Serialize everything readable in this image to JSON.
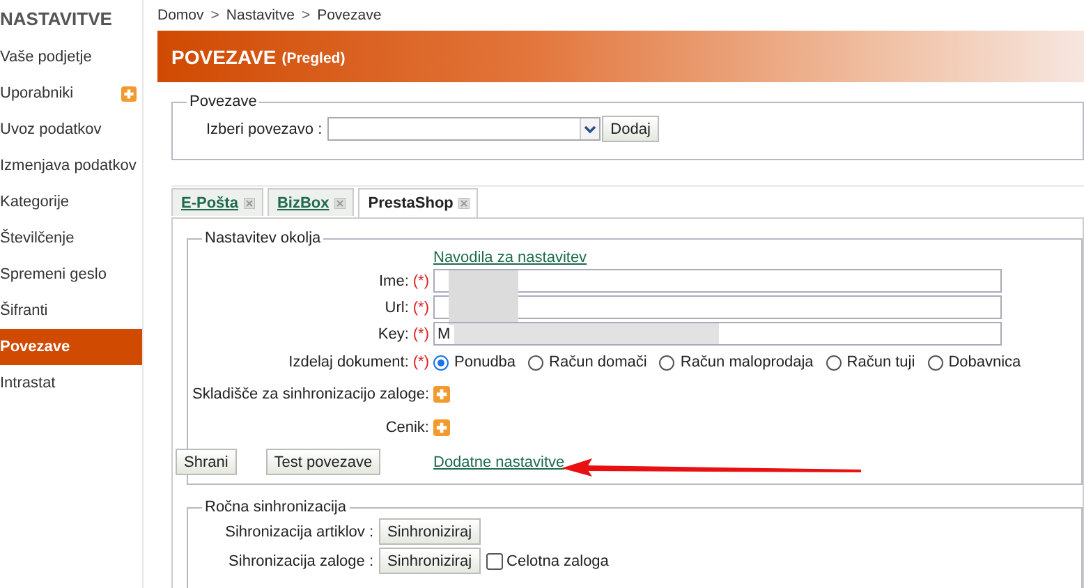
{
  "sidebar": {
    "title": "NASTAVITVE",
    "items": [
      {
        "label": "Vaše podjetje",
        "selected": false,
        "plus": false
      },
      {
        "label": "Uporabniki",
        "selected": false,
        "plus": true
      },
      {
        "label": "Uvoz podatkov",
        "selected": false,
        "plus": false
      },
      {
        "label": "Izmenjava podatkov",
        "selected": false,
        "plus": false
      },
      {
        "label": "Kategorije",
        "selected": false,
        "plus": false
      },
      {
        "label": "Številčenje",
        "selected": false,
        "plus": false
      },
      {
        "label": "Spremeni geslo",
        "selected": false,
        "plus": false
      },
      {
        "label": "Šifranti",
        "selected": false,
        "plus": false
      },
      {
        "label": "Povezave",
        "selected": true,
        "plus": false
      },
      {
        "label": "Intrastat",
        "selected": false,
        "plus": false
      }
    ]
  },
  "breadcrumb": [
    "Domov",
    "Nastavitve",
    "Povezave"
  ],
  "breadcrumb_separator": ">",
  "header": {
    "title": "POVEZAVE",
    "subtitle": "(Pregled)"
  },
  "connection_picker": {
    "legend": "Povezave",
    "label": "Izberi povezavo :",
    "button": "Dodaj"
  },
  "tabs": [
    {
      "label": "E-Pošta",
      "selected": false
    },
    {
      "label": "BizBox",
      "selected": false
    },
    {
      "label": "PrestaShop",
      "selected": true
    }
  ],
  "settings": {
    "legend": "Nastavitev okolja",
    "help_link": "Navodila za nastavitev",
    "required_mark": "(*)",
    "fields": [
      {
        "label": "Ime:",
        "redacted": true
      },
      {
        "label": "Url:",
        "redacted": true
      },
      {
        "label": "Key:",
        "value": "M",
        "redacted": true
      }
    ],
    "document_label": "Izdelaj dokument:",
    "document_options": [
      {
        "label": "Ponudba",
        "selected": true
      },
      {
        "label": "Račun domači",
        "selected": false
      },
      {
        "label": "Račun maloprodaja",
        "selected": false
      },
      {
        "label": "Račun tuji",
        "selected": false
      },
      {
        "label": "Dobavnica",
        "selected": false
      }
    ],
    "add_rows": [
      {
        "label": "Skladišče za sinhronizacijo zaloge:"
      },
      {
        "label": "Cenik:"
      }
    ],
    "buttons": [
      "Shrani",
      "Test povezave"
    ],
    "extra_link": "Dodatne nastavitve"
  },
  "manual_sync": {
    "legend": "Ročna sinhronizacija",
    "rows": [
      {
        "label": "Sihronizacija artiklov :",
        "button": "Sinhroniziraj"
      },
      {
        "label": "Sihronizacija zaloge :",
        "button": "Sinhroniziraj",
        "checkbox": {
          "label": "Celotna zaloga",
          "checked": false
        }
      }
    ]
  }
}
